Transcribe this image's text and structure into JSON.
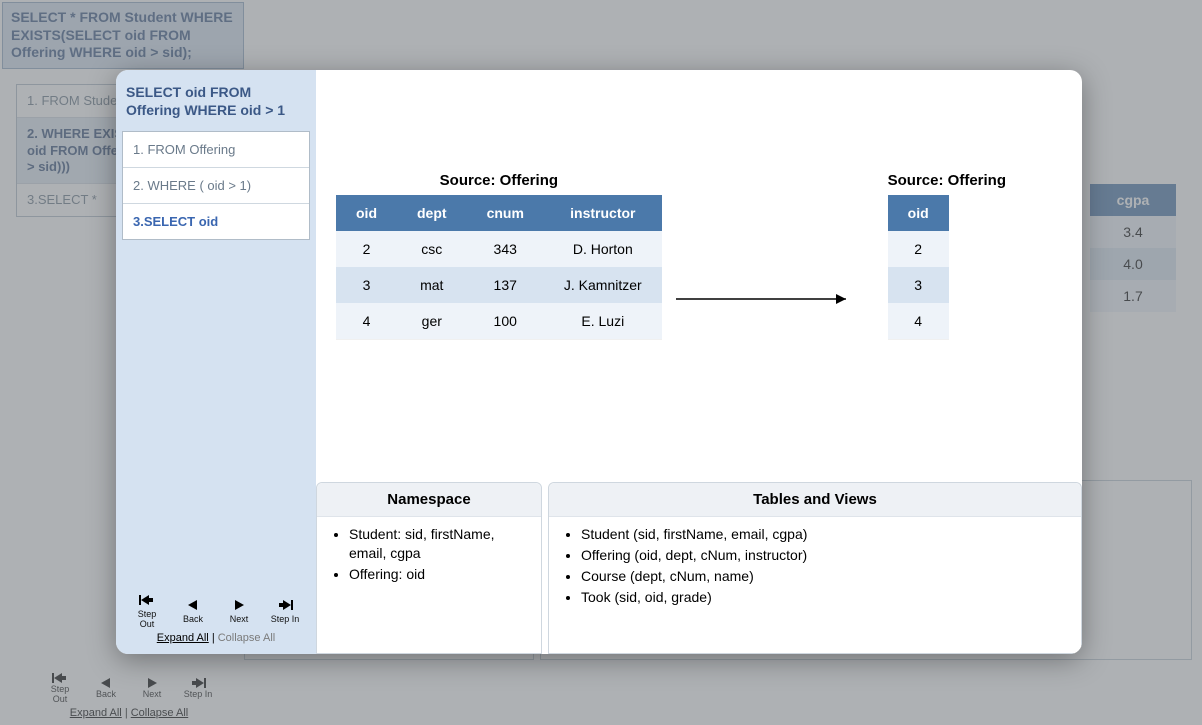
{
  "bg": {
    "query": "SELECT * FROM Student WHERE EXISTS(SELECT oid FROM Offering WHERE oid > sid);",
    "steps": [
      {
        "label": "1. FROM Student",
        "active": false
      },
      {
        "label": "2. WHERE EXISTS((SELECT oid FROM Offering WHERE oid > sid)))",
        "active": true
      },
      {
        "label": "3.SELECT *",
        "active": false
      }
    ],
    "cgpa_header": "cgpa",
    "cgpa_rows": [
      "3.4",
      "4.0",
      "1.7"
    ],
    "controls": {
      "step_out": "Step Out",
      "back": "Back",
      "next": "Next",
      "step_in": "Step In",
      "expand": "Expand All",
      "collapse": "Collapse All"
    }
  },
  "modal": {
    "query": "SELECT oid FROM Offering WHERE oid > 1",
    "steps": [
      {
        "label": "1. FROM Offering",
        "active": false
      },
      {
        "label": "2. WHERE ( oid > 1)",
        "active": false
      },
      {
        "label": "3.SELECT oid",
        "active": true
      }
    ],
    "source_left": {
      "caption": "Source: Offering",
      "headers": [
        "oid",
        "dept",
        "cnum",
        "instructor"
      ],
      "rows": [
        [
          "2",
          "csc",
          "343",
          "D. Horton"
        ],
        [
          "3",
          "mat",
          "137",
          "J. Kamnitzer"
        ],
        [
          "4",
          "ger",
          "100",
          "E. Luzi"
        ]
      ]
    },
    "source_right": {
      "caption": "Source: Offering",
      "headers": [
        "oid"
      ],
      "rows": [
        [
          "2"
        ],
        [
          "3"
        ],
        [
          "4"
        ]
      ]
    },
    "namespace": {
      "title": "Namespace",
      "items": [
        "Student: sid, firstName, email, cgpa",
        "Offering: oid"
      ]
    },
    "tables_views": {
      "title": "Tables and Views",
      "items": [
        "Student (sid, firstName, email, cgpa)",
        "Offering (oid, dept, cNum, instructor)",
        "Course (dept, cNum, name)",
        "Took (sid, oid, grade)"
      ]
    },
    "controls": {
      "step_out": "Step Out",
      "back": "Back",
      "next": "Next",
      "step_in": "Step In",
      "expand": "Expand All",
      "collapse": "Collapse All",
      "sep": " | "
    }
  }
}
